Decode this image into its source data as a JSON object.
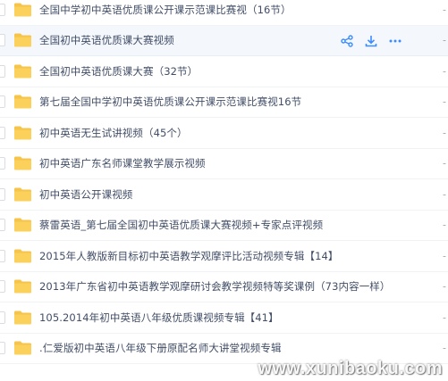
{
  "files": [
    {
      "name": "全国中学初中英语优质课公开课示范课比赛视（16节）",
      "size": "-"
    },
    {
      "name": "全国初中英语优质课大赛视频",
      "size": "-",
      "hovered": true
    },
    {
      "name": "全国初中英语优质课大赛（32节）",
      "size": "-"
    },
    {
      "name": "第七届全国中学初中英语优质课公开课示范课比赛视16节",
      "size": "-"
    },
    {
      "name": "初中英语无生试讲视频（45个）",
      "size": "-"
    },
    {
      "name": "初中英语广东名师课堂教学展示视频",
      "size": "-"
    },
    {
      "name": "初中英语公开课视频",
      "size": "-"
    },
    {
      "name": "蔡雷英语_第七届全国初中英语优质课大赛视频+专家点评视频",
      "size": "-"
    },
    {
      "name": "2015年人教版新目标初中英语教学观摩评比活动视频专辑【14】",
      "size": "-"
    },
    {
      "name": "2013年广东省初中英语教学观摩研讨会教学视频特等奖课例（73内容一样）",
      "size": "-"
    },
    {
      "name": "105.2014年初中英语八年级优质课视频专辑【41】",
      "size": "-"
    },
    {
      "name": ".仁爱版初中英语八年级下册原配名师大讲堂视频专辑",
      "size": "-"
    }
  ],
  "row_actions": [
    {
      "icon": "share-icon"
    },
    {
      "icon": "download-icon"
    },
    {
      "icon": "more-icon"
    }
  ],
  "watermark": "www.xunibaoku.com",
  "colors": {
    "folder": "#f7c44a",
    "accent": "#3b8cff",
    "text": "#424e67"
  }
}
